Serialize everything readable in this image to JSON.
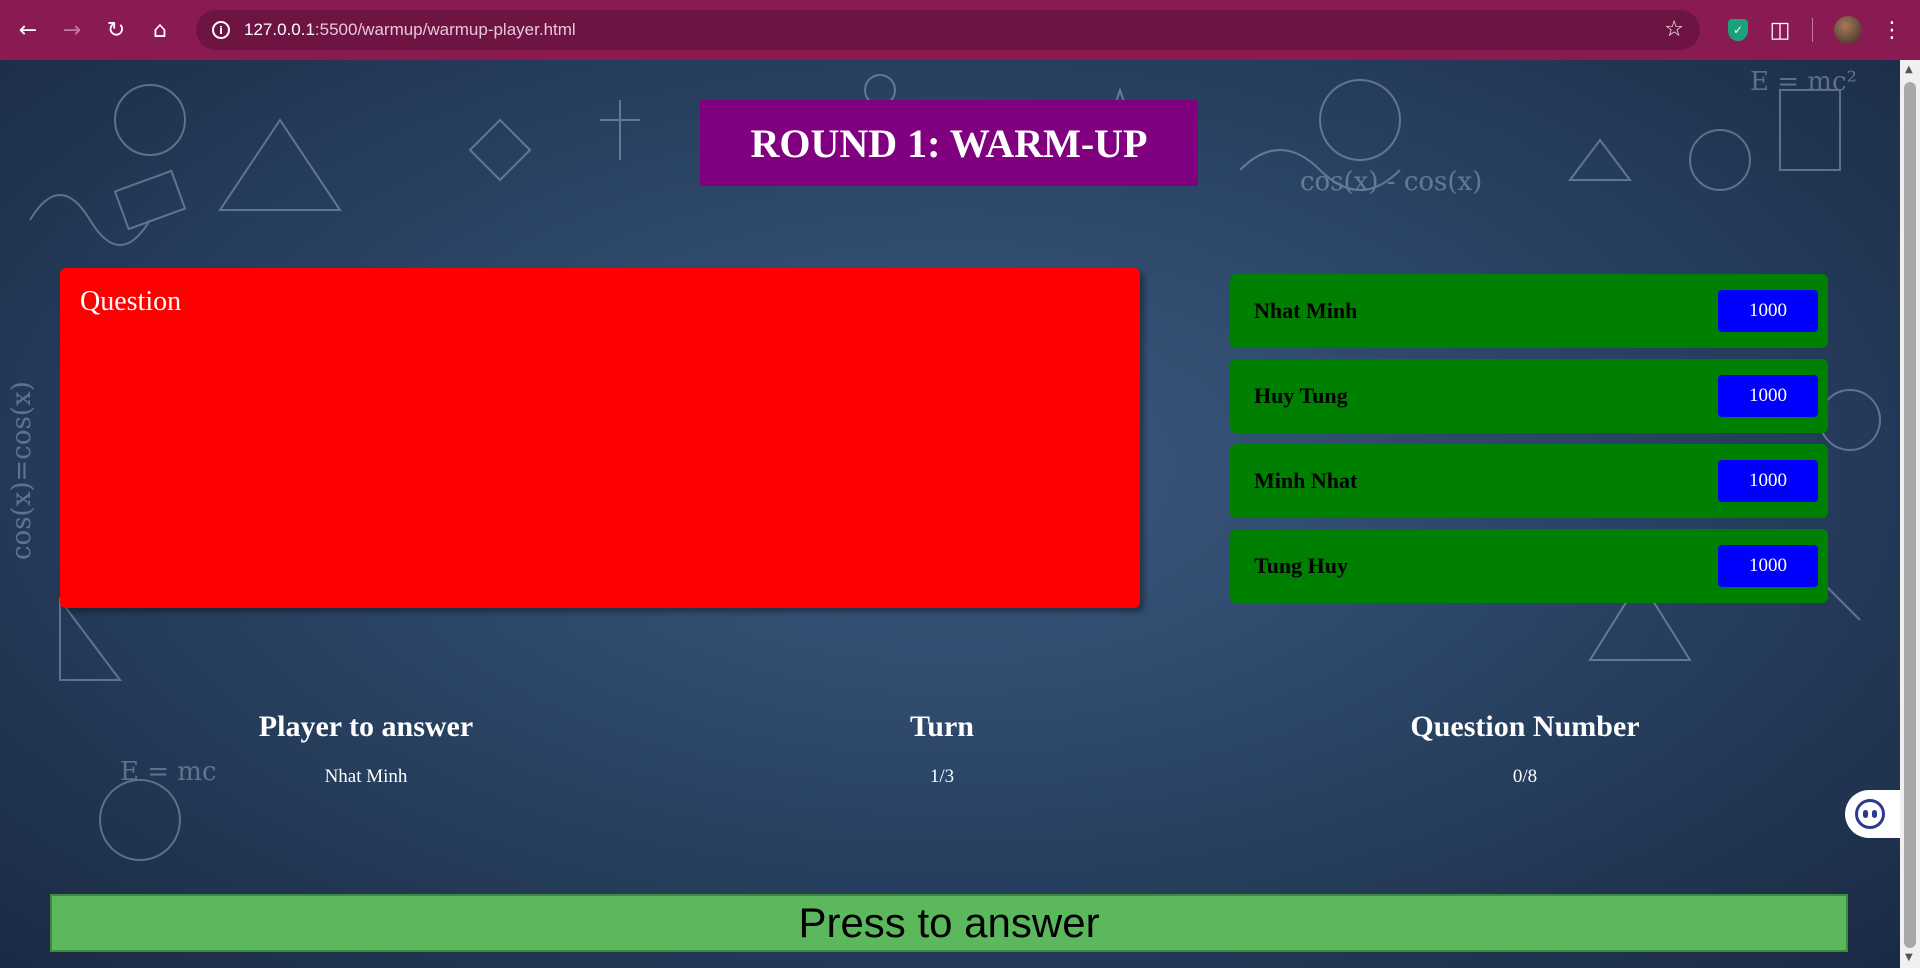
{
  "browser": {
    "url_host": "127.0.0.1",
    "url_path": ":5500/warmup/warmup-player.html"
  },
  "page": {
    "title": "ROUND 1: WARM-UP",
    "question_label": "Question",
    "players": [
      {
        "name": "Nhat Minh",
        "score": "1000"
      },
      {
        "name": "Huy Tung",
        "score": "1000"
      },
      {
        "name": "Minh Nhat",
        "score": "1000"
      },
      {
        "name": "Tung Huy",
        "score": "1000"
      }
    ],
    "info": {
      "player_label": "Player to answer",
      "player_value": "Nhat Minh",
      "turn_label": "Turn",
      "turn_value": "1/3",
      "question_number_label": "Question Number",
      "question_number_value": "0/8"
    },
    "answer_button": "Press to answer"
  },
  "colors": {
    "chrome": "#8a1a52",
    "title_bg": "#800080",
    "question_bg": "#ff0000",
    "player_bg": "#008000",
    "score_bg": "#0000ff",
    "answer_bg": "#5cb85c"
  }
}
